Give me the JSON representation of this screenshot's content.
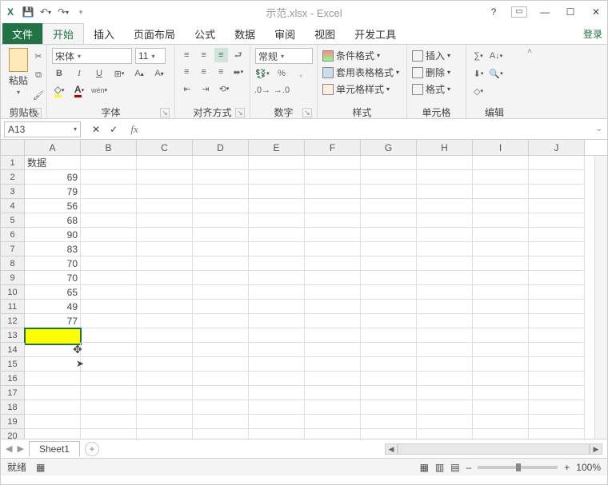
{
  "title": "示范.xlsx - Excel",
  "tabs": {
    "file": "文件",
    "home": "开始",
    "insert": "插入",
    "layout": "页面布局",
    "formula": "公式",
    "data": "数据",
    "review": "审阅",
    "view": "视图",
    "dev": "开发工具"
  },
  "login": "登录",
  "ribbon": {
    "clipboard": {
      "paste": "粘贴",
      "label": "剪贴板"
    },
    "font": {
      "name": "宋体",
      "size": "11",
      "label": "字体",
      "b": "B",
      "i": "I",
      "u": "U"
    },
    "align": {
      "label": "对齐方式"
    },
    "number": {
      "format": "常规",
      "label": "数字"
    },
    "styles": {
      "cond": "条件格式",
      "table": "套用表格格式",
      "cell": "单元格样式",
      "label": "样式"
    },
    "cells": {
      "insert": "插入",
      "delete": "删除",
      "format": "格式",
      "label": "单元格"
    },
    "editing": {
      "label": "编辑"
    }
  },
  "namebox": "A13",
  "columns": [
    "A",
    "B",
    "C",
    "D",
    "E",
    "F",
    "G",
    "H",
    "I",
    "J"
  ],
  "rowdata": {
    "header": "数据",
    "values": [
      "69",
      "79",
      "56",
      "68",
      "90",
      "83",
      "70",
      "70",
      "65",
      "49",
      "77"
    ]
  },
  "rowcount": 20,
  "selected_row": 13,
  "sheet": "Sheet1",
  "status": {
    "ready": "就绪",
    "zoom": "100%"
  }
}
